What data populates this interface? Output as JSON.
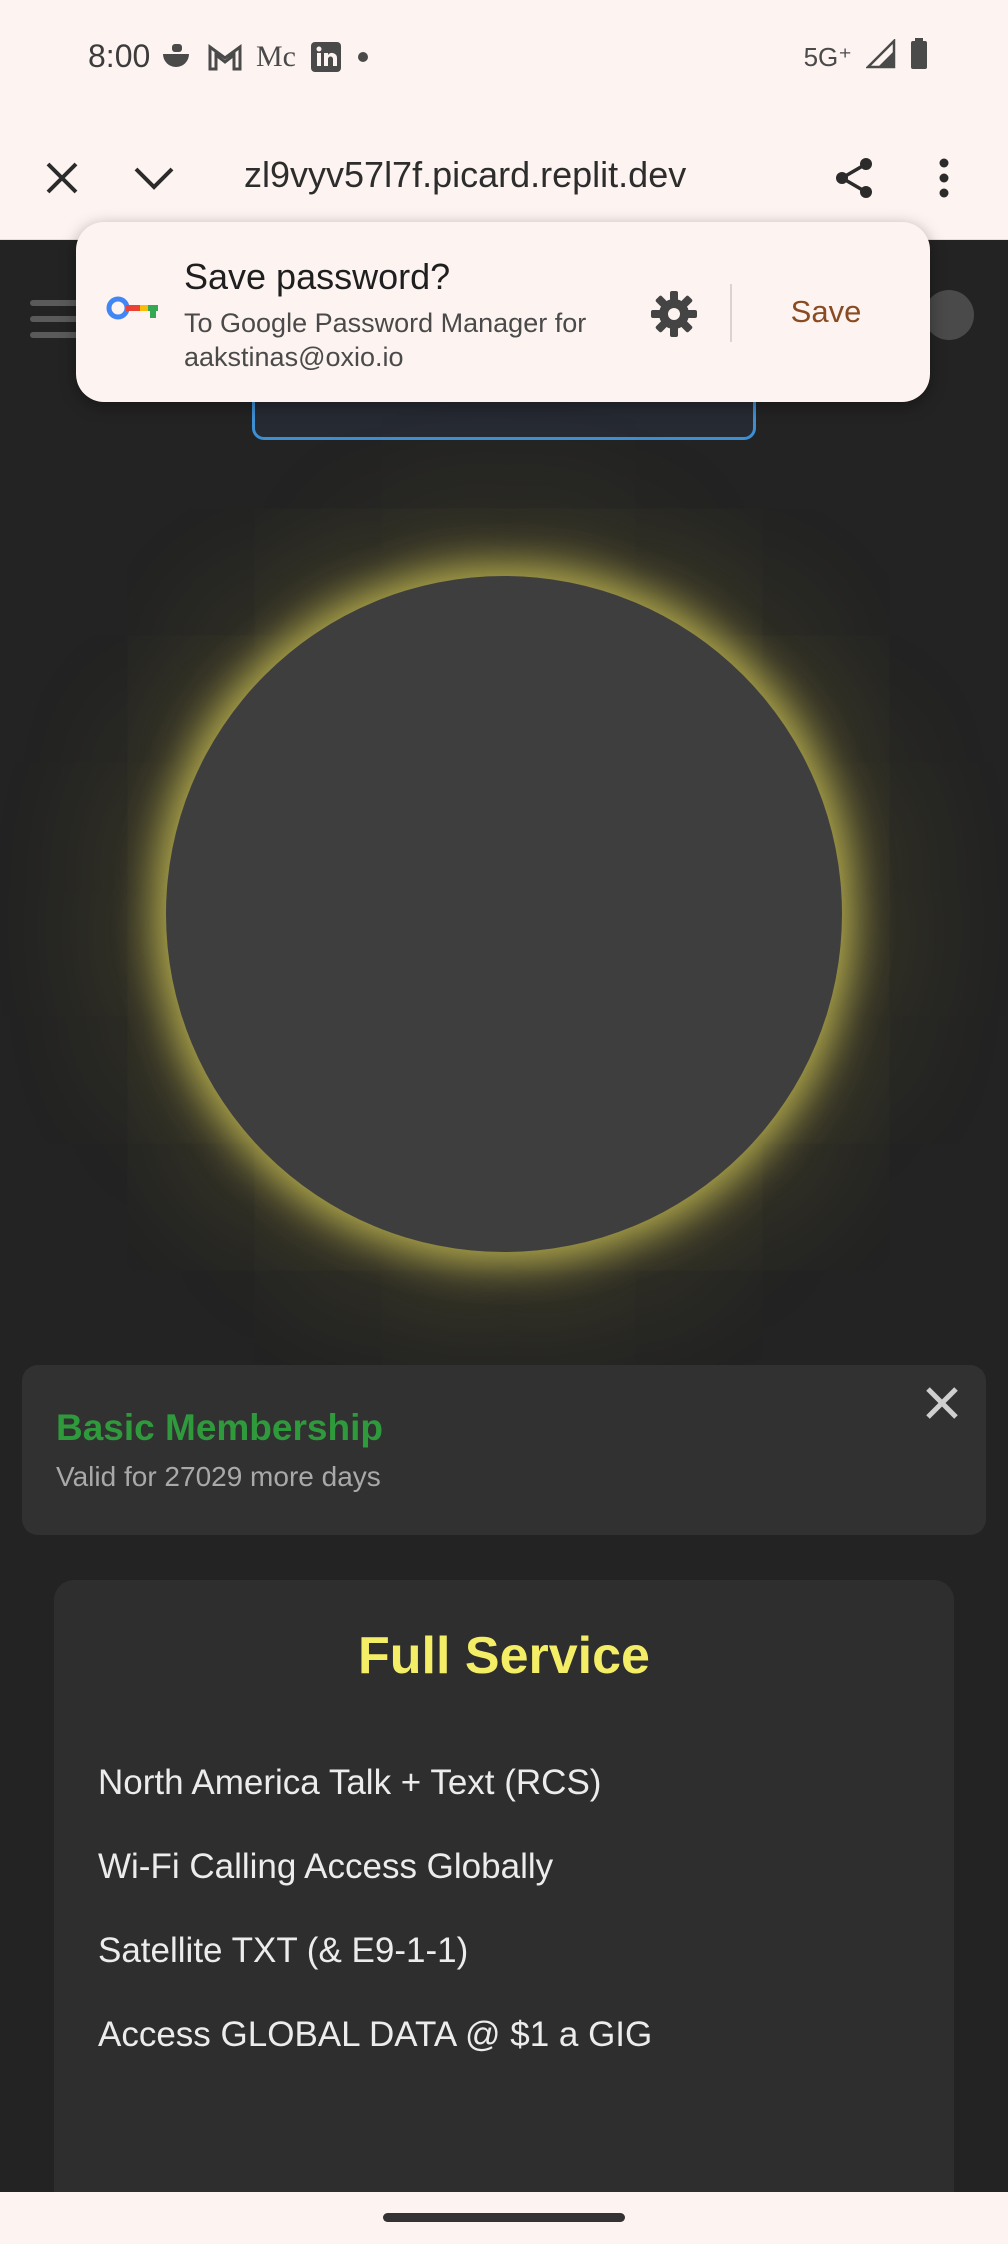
{
  "status_bar": {
    "time": "8:00",
    "network": "5G⁺"
  },
  "browser": {
    "url": "zl9vyv57l7f.picard.replit.dev"
  },
  "password_prompt": {
    "title": "Save password?",
    "description": "To Google Password Manager for aakstinas@oxio.io",
    "save_label": "Save"
  },
  "membership": {
    "title": "Basic Membership",
    "subtitle": "Valid for 27029 more days",
    "title_color": "#2f9a3c"
  },
  "service": {
    "title": "Full Service",
    "title_color": "#f4ee66",
    "features": [
      "North America Talk + Text (RCS)",
      "Wi-Fi Calling Access Globally",
      "Satellite TXT (& E9-1-1)",
      "Access GLOBAL DATA @ $1 a GIG"
    ]
  }
}
